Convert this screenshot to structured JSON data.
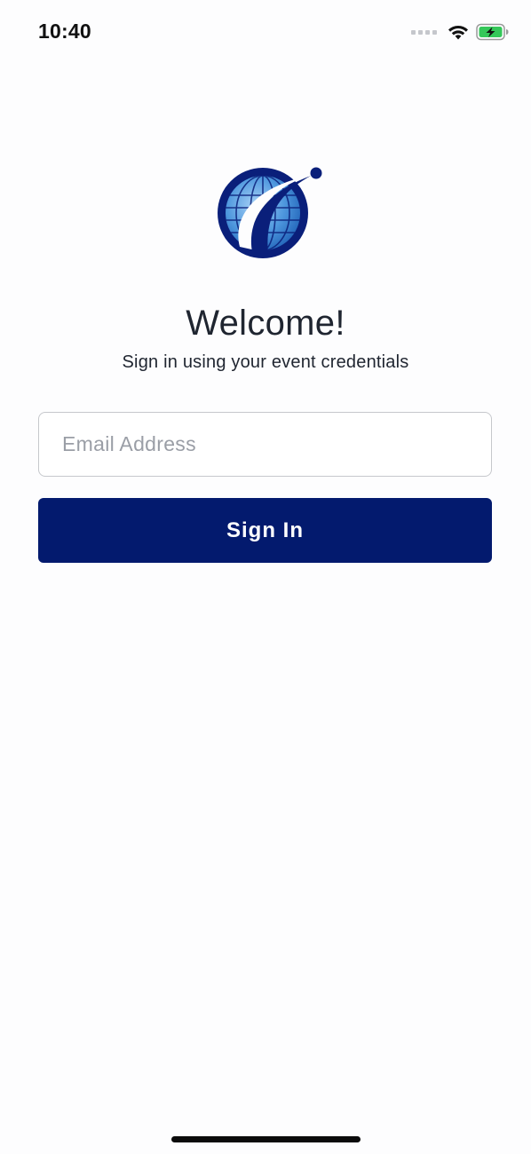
{
  "status_bar": {
    "time": "10:40",
    "wifi_icon": "wifi-icon",
    "battery_icon": "battery-charging-icon",
    "battery_color": "#34c759"
  },
  "logo": {
    "icon": "globe-logo-icon",
    "colors": {
      "navy": "#0a1f7a",
      "blue": "#2d7fd3",
      "light": "#8ec0ef"
    }
  },
  "login": {
    "title": "Welcome!",
    "subtitle": "Sign in using your event credentials",
    "email_placeholder": "Email Address",
    "email_value": "",
    "sign_in_label": "Sign In",
    "accent_color": "#031a6e"
  }
}
